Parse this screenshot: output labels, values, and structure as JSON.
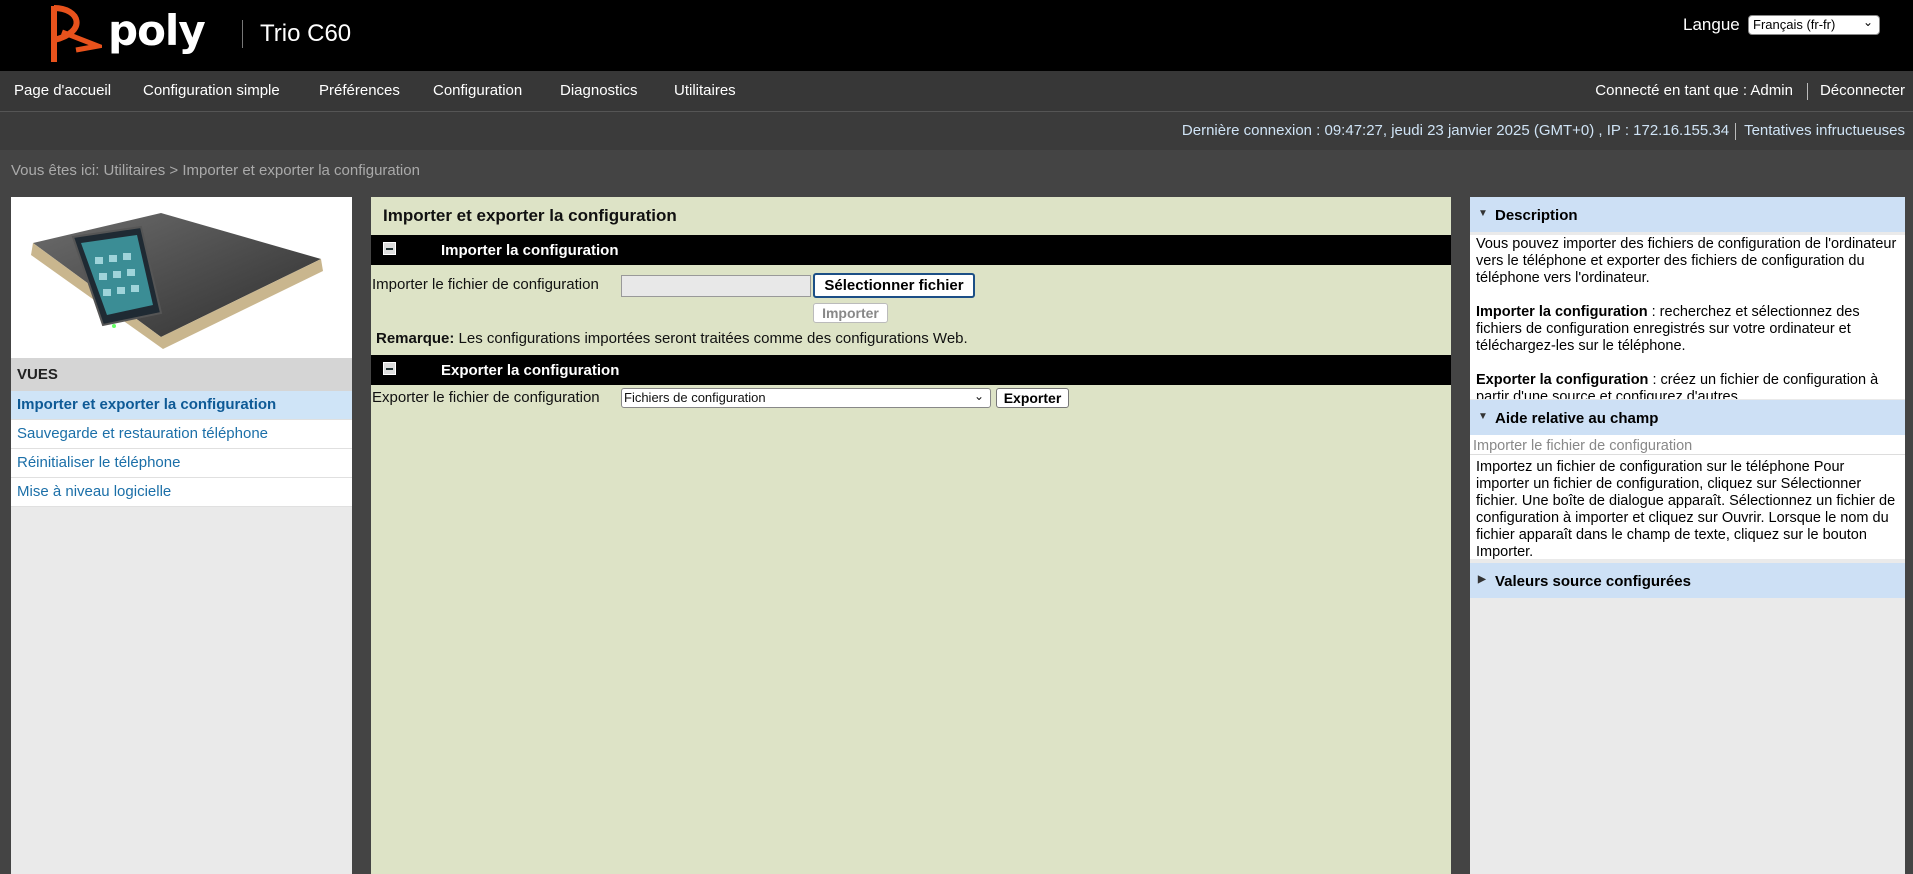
{
  "header": {
    "brand": "poly",
    "product": "Trio C60",
    "language_label": "Langue",
    "language_value": "Français (fr-fr)",
    "brand_color": "#e8521c"
  },
  "nav": {
    "items": [
      "Page d'accueil",
      "Configuration simple",
      "Préférences",
      "Configuration",
      "Diagnostics",
      "Utilitaires"
    ],
    "connected_as": "Connecté en tant que : Admin",
    "logout": "Déconnecter"
  },
  "info": {
    "last_login": "Dernière connexion : 09:47:27, jeudi 23 janvier 2025 (GMT+0) , IP : 172.16.155.34",
    "failed_attempts": "Tentatives infructueuses"
  },
  "breadcrumb": "Vous êtes ici: Utilitaires > Importer et exporter la configuration",
  "left": {
    "views_title": "VUES",
    "views": [
      {
        "label": "Importer et exporter la configuration",
        "active": true
      },
      {
        "label": "Sauvegarde et restauration téléphone",
        "active": false
      },
      {
        "label": "Réinitialiser le téléphone",
        "active": false
      },
      {
        "label": "Mise à niveau logicielle",
        "active": false
      }
    ]
  },
  "main": {
    "title": "Importer et exporter la configuration",
    "import_section": "Importer la configuration",
    "import_label": "Importer le fichier de configuration",
    "select_file_button": "Sélectionner fichier",
    "import_button": "Importer",
    "remark_label": "Remarque:",
    "remark_text": " Les configurations importées seront traitées comme des configurations Web.",
    "export_section": "Exporter la configuration",
    "export_label": "Exporter le fichier de configuration",
    "export_select_value": "Fichiers de configuration",
    "export_button": "Exporter"
  },
  "right": {
    "description_title": "Description",
    "description_intro": "Vous pouvez importer des fichiers de configuration de l'ordinateur vers le téléphone et exporter des fichiers de configuration du téléphone vers l'ordinateur.",
    "desc_import_bold": "Importer la configuration",
    "desc_import_text": " : recherchez et sélectionnez des fichiers de configuration enregistrés sur votre ordinateur et téléchargez-les sur le téléphone.",
    "desc_export_bold": "Exporter la configuration",
    "desc_export_text": " : créez un fichier de configuration à partir d'une source et configurez d'autres",
    "field_help_title": "Aide relative au champ",
    "field_help_name": "Importer le fichier de configuration",
    "field_help_text": "Importez un fichier de configuration sur le téléphone Pour importer un fichier de configuration, cliquez sur Sélectionner fichier. Une boîte de dialogue apparaît. Sélectionnez un fichier de configuration à importer et cliquez sur Ouvrir. Lorsque le nom du fichier apparaît dans le champ de texte, cliquez sur le bouton Importer.",
    "source_values_title": "Valeurs source configurées"
  }
}
